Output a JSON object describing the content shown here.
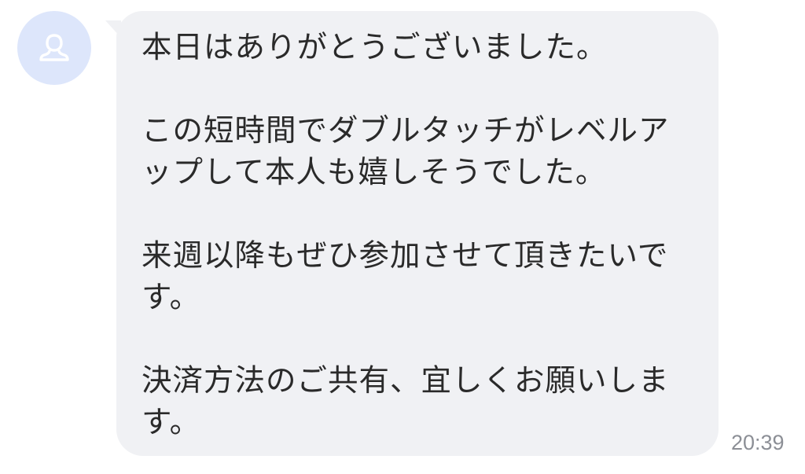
{
  "message": {
    "paragraphs": [
      "本日はありがとうございました。",
      "この短時間でダブルタッチがレベルアップして本人も嬉しそうでした。",
      "来週以降もぜひ参加させて頂きたいです。",
      "決済方法のご共有、宜しくお願いします。"
    ],
    "time": "20:39"
  },
  "avatar": {
    "icon": "user-silhouette-icon",
    "color": "#dde6fb",
    "icon_color": "#ffffff"
  },
  "colors": {
    "bubble": "#f0f1f4",
    "text": "#2a2a2a",
    "timestamp": "#8c8f96"
  }
}
